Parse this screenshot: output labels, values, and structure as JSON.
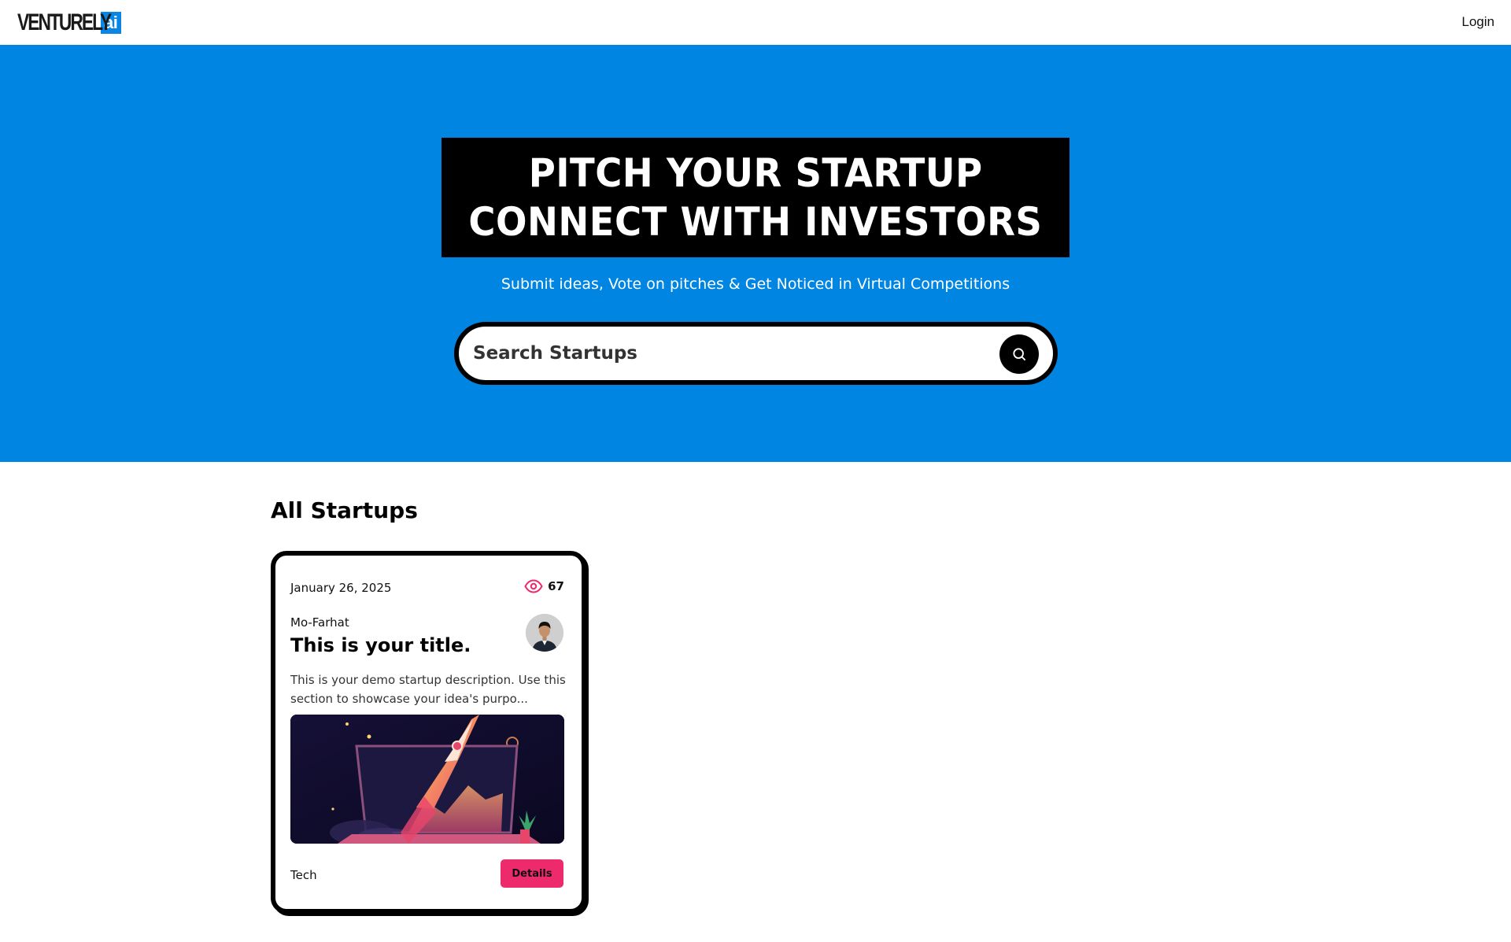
{
  "header": {
    "logo_text": "VENTURELY",
    "logo_badge": "ai",
    "login_label": "Login"
  },
  "hero": {
    "headline_line1": "PITCH YOUR STARTUP",
    "headline_line2": "CONNECT WITH INVESTORS",
    "subtitle": "Submit ideas, Vote on pitches & Get Noticed in Virtual Competitions",
    "search": {
      "placeholder": "Search Startups",
      "value": ""
    }
  },
  "main": {
    "section_title": "All Startups",
    "cards": [
      {
        "date": "January 26, 2025",
        "views": "67",
        "author": "Mo-Farhat",
        "title": "This is your title.",
        "description": "This is your demo startup description. Use this section to showcase your idea's purpo...",
        "category": "Tech",
        "details_label": "Details"
      }
    ]
  },
  "colors": {
    "brand_blue": "#0085e2",
    "accent_pink": "#ed2a6b",
    "black": "#000000"
  },
  "icons": {
    "search": "search-icon",
    "views": "eye-icon"
  }
}
